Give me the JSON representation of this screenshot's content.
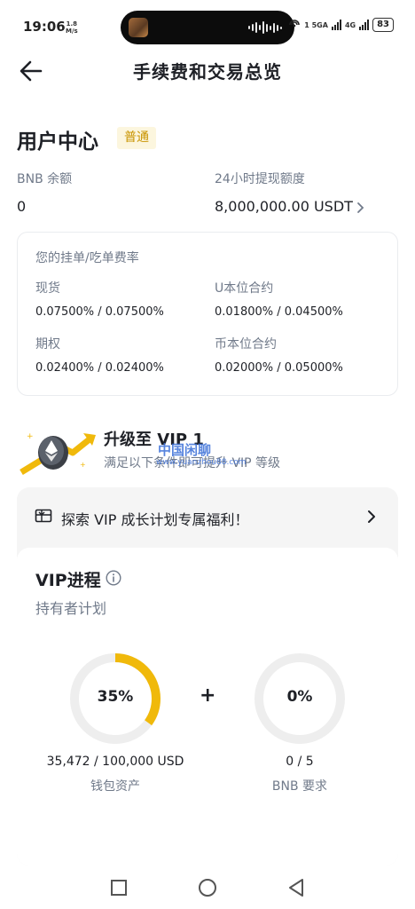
{
  "status_bar": {
    "time": "19:06",
    "speed_value": "1.8",
    "speed_unit": "M/s",
    "network_1": "1 5GA",
    "network_2": "4G",
    "battery": "83"
  },
  "header": {
    "title": "手续费和交易总览"
  },
  "user_center": {
    "title": "用户中心",
    "tier": "普通",
    "bnb_label": "BNB 余额",
    "bnb_value": "0",
    "withdraw_label": "24小时提现额度",
    "withdraw_value": "8,000,000.00 USDT"
  },
  "fee_rates": {
    "header": "您的挂单/吃单费率",
    "items": [
      {
        "label": "现货",
        "value": "0.07500% / 0.07500%"
      },
      {
        "label": "U本位合约",
        "value": "0.01800% / 0.04500%"
      },
      {
        "label": "期权",
        "value": "0.02400% / 0.02400%"
      },
      {
        "label": "币本位合约",
        "value": "0.02000% / 0.05000%"
      }
    ]
  },
  "vip_upgrade": {
    "title": "升级至 VIP 1",
    "subtitle": "满足以下条件即可提升 VIP 等级",
    "watermark": "中国闲聊",
    "watermark_sub": "www.yuanzhou88.com"
  },
  "vip_program": {
    "explore_text": "探索 VIP 成长计划专属福利！",
    "progress_title": "VIP进程",
    "plan_name": "持有者计划",
    "plus": "+",
    "wallet": {
      "percent_label": "35%",
      "progress": 0.35,
      "amount": "35,472 / 100,000 USD",
      "caption": "钱包资产"
    },
    "bnb": {
      "percent_label": "0%",
      "progress": 0,
      "amount": "0 / 5",
      "caption": "BNB 要求"
    },
    "accent_color": "#f0b90b",
    "track_color": "#eeeeee"
  },
  "icons": {
    "back": "arrow-left-icon",
    "chevron": "chevron-right-icon",
    "info": "info-circle-icon",
    "gift": "gift-card-icon",
    "nav_recent": "square-icon",
    "nav_home": "circle-icon",
    "nav_back": "triangle-back-icon"
  }
}
